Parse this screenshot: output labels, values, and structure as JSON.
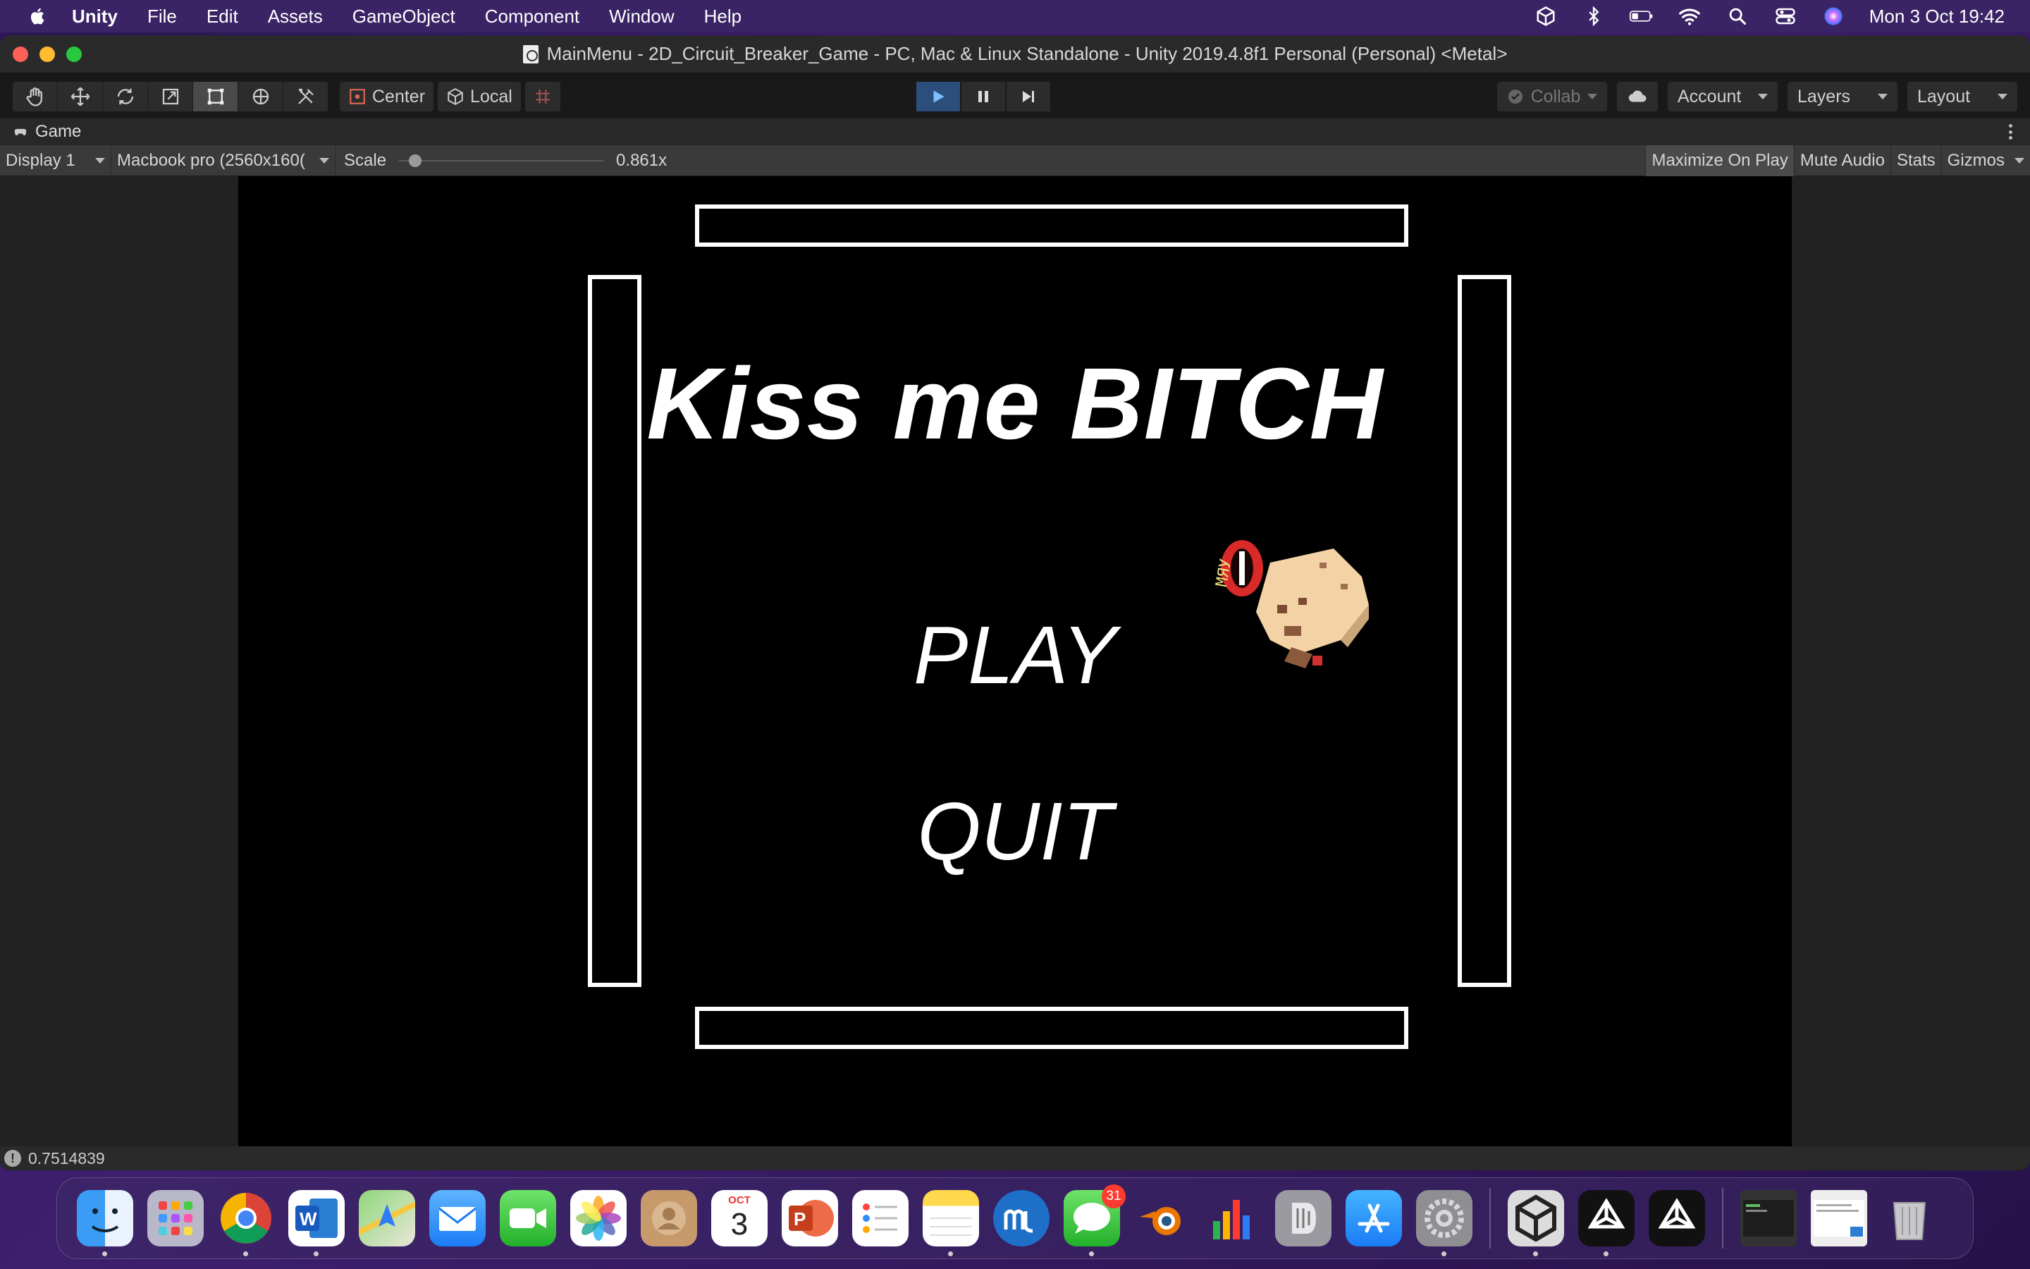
{
  "menubar": {
    "app_name": "Unity",
    "items": [
      "File",
      "Edit",
      "Assets",
      "GameObject",
      "Component",
      "Window",
      "Help"
    ],
    "clock": "Mon 3 Oct  19:42"
  },
  "window": {
    "title": "MainMenu - 2D_Circuit_Breaker_Game - PC, Mac & Linux Standalone - Unity 2019.4.8f1 Personal (Personal) <Metal>"
  },
  "toolbar": {
    "pivot_label": "Center",
    "space_label": "Local",
    "collab_label": "Collab",
    "account_label": "Account",
    "layers_label": "Layers",
    "layout_label": "Layout"
  },
  "game_tab": {
    "label": "Game",
    "display": "Display 1",
    "resolution": "Macbook pro (2560x160(",
    "scale_label": "Scale",
    "scale_value": "0.861x",
    "scale_level": 0.05,
    "maximize_label": "Maximize On Play",
    "mute_label": "Mute Audio",
    "stats_label": "Stats",
    "gizmos_label": "Gizmos"
  },
  "game": {
    "title": "Kiss me BITCH",
    "play_label": "PLAY",
    "quit_label": "QUIT"
  },
  "statusbar": {
    "message": "0.7514839"
  },
  "dock": {
    "messages_badge": "31",
    "calendar_month": "OCT",
    "calendar_day": "3"
  },
  "colors": {
    "menubar_bg": "#3a2466",
    "play_active": "#2b4f7a",
    "game_bg": "#000000"
  }
}
